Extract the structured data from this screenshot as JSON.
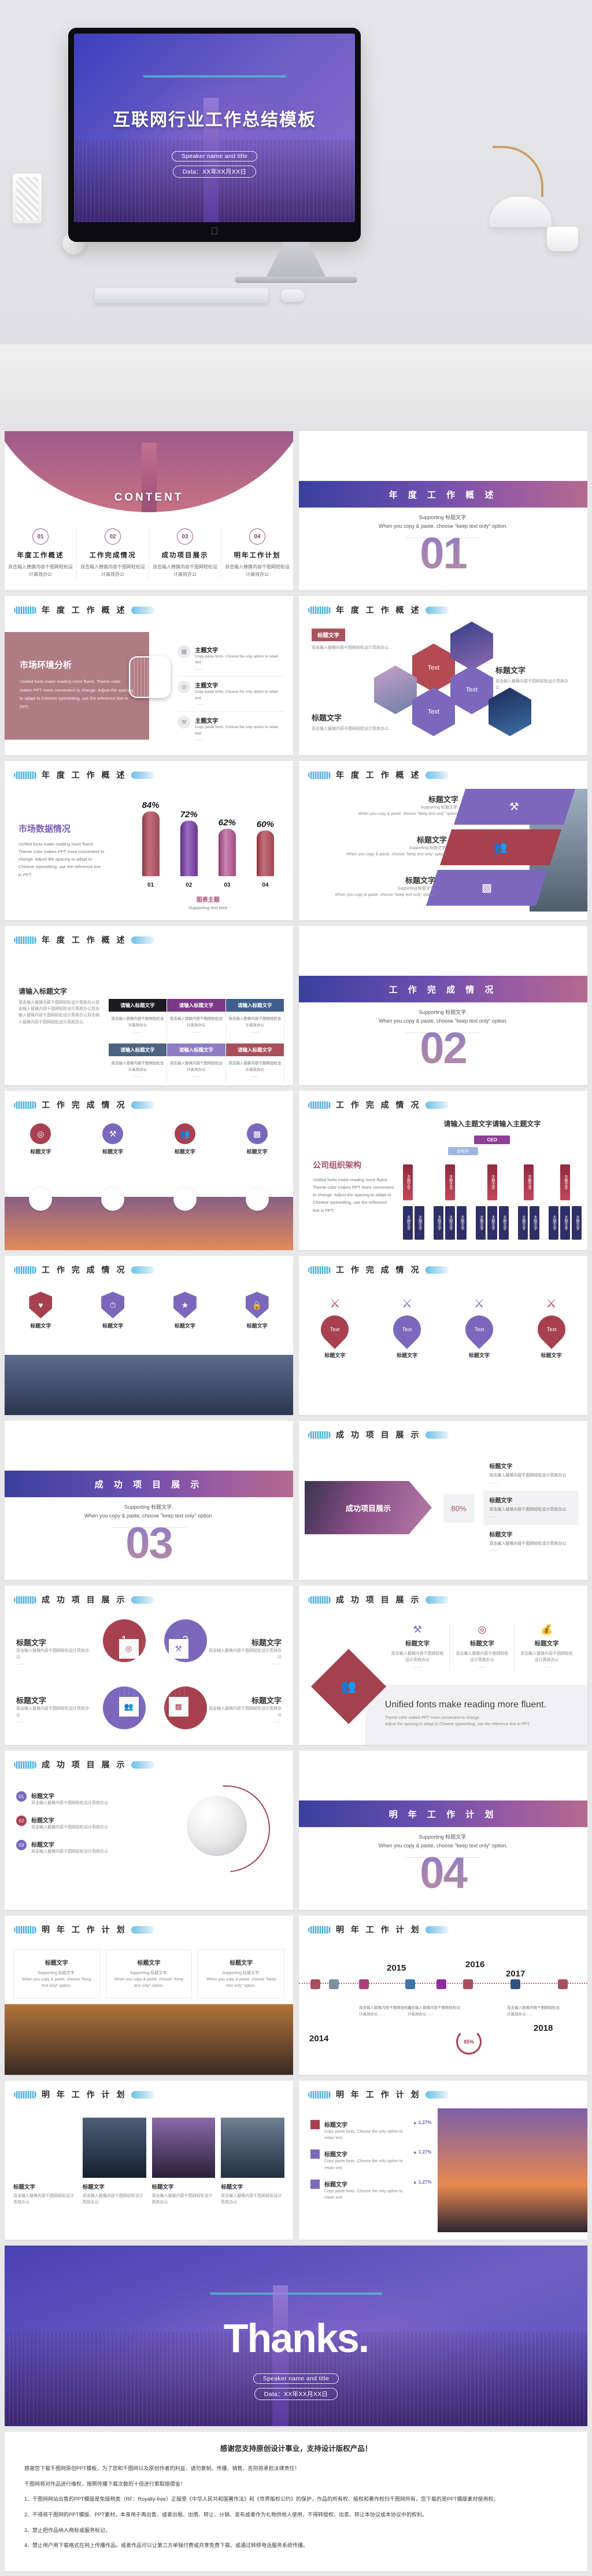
{
  "hero": {
    "title": "互联网行业工作总结模板",
    "speaker": "Speaker name and title",
    "date": "Data：XX年XX月XX日",
    "apple_logo": "apple-logo"
  },
  "colors": {
    "purple": "#7b68bd",
    "deep_purple": "#5a4fb8",
    "red": "#a8414f",
    "rose": "#b07c84",
    "blue_ribbon": "#6ec0e6",
    "magenta": "#8e3f96"
  },
  "content_slide": {
    "word": "CONTENT",
    "columns": [
      {
        "num": "01",
        "title": "年度工作概述",
        "desc": "双击输入替换内容千图网轻松设计高效办公"
      },
      {
        "num": "02",
        "title": "工作完成情况",
        "desc": "双击输入替换内容千图网轻松设计高效办公"
      },
      {
        "num": "03",
        "title": "成功项目展示",
        "desc": "双击输入替换内容千图网轻松设计高效办公"
      },
      {
        "num": "04",
        "title": "明年工作计划",
        "desc": "双击输入替换内容千图网轻松设计高效办公"
      }
    ]
  },
  "dividers": [
    {
      "num": "01",
      "title": "年 度 工 作 概 述",
      "sub1": "Supporting 标题文字.",
      "sub2": "When you copy & paste, choose \"keep text only\" option."
    },
    {
      "num": "02",
      "title": "工 作 完 成 情 况",
      "sub1": "Supporting 标题文字.",
      "sub2": "When you copy & paste, choose \"keep text only\" option."
    },
    {
      "num": "03",
      "title": "成 功 项 目 展 示",
      "sub1": "Supporting 标题文字.",
      "sub2": "When you copy & paste, choose \"keep text only\" option."
    },
    {
      "num": "04",
      "title": "明 年 工 作 计 划",
      "sub1": "Supporting 标题文字.",
      "sub2": "When you copy & paste, choose \"keep text only\" option."
    }
  ],
  "section_titles": {
    "s1": "年 度 工 作 概 述",
    "s2": "工 作 完 成 情 况",
    "s3": "成 功 项 目 展 示",
    "s4": "明 年 工 作 计 划"
  },
  "market": {
    "heading": "市场环境分析",
    "body": "Unified fonts make reading more fluent. Theme color makes PPT more convenient to change. Adjust the spacing to adapt to Chinese typesetting, use the reference line in PPT.",
    "items": [
      {
        "icon": "bar-chart-icon",
        "title": "主题文字",
        "line1": "Copy paste fonts. Choose the only option to retain text.",
        "line2": "……"
      },
      {
        "icon": "target-icon",
        "title": "主题文字",
        "line1": "Copy paste fonts. Choose the only option to retain text.",
        "line2": "……"
      },
      {
        "icon": "tools-icon",
        "title": "主题文字",
        "line1": "Copy paste fonts. Choose the only option to retain text.",
        "line2": "……"
      }
    ]
  },
  "hex_slide": {
    "tag": "标题文字",
    "tag_desc": "双击输入替换内容千图网轻松设计高效办公…",
    "right_title": "标题文字",
    "right_desc": "双击输入替换内容千图网轻松设计高效办公…",
    "bottom_title": "标题文字",
    "bottom_desc": "双击输入替换内容千图网轻松设计高效办公…",
    "hex_label": "Text"
  },
  "chart_data": {
    "type": "bar",
    "title": "市场数据情况",
    "categories": [
      "01",
      "02",
      "03",
      "04"
    ],
    "values": [
      84,
      72,
      62,
      60
    ],
    "value_labels": [
      "84%",
      "72%",
      "62%",
      "60%"
    ],
    "bar_colors": [
      "#b5545f",
      "#7a3f9e",
      "#b4528c",
      "#b9505c"
    ],
    "chart_caption": "图表主题",
    "chart_sub": "Supporting text here",
    "side_text": "Unified fonts make reading more fluent. Theme color makes PPT more convenient to change. Adjust the spacing to adapt to Chinese typesetting, use the reference line in PPT.",
    "xlabel": "",
    "ylabel": "",
    "ylim": [
      0,
      100
    ],
    "grid": false,
    "legend": "none"
  },
  "parallelogram": {
    "rows": [
      {
        "title": "标题文字",
        "l1": "Supporting 标题文字.",
        "l2": "When you copy & paste, choose \"keep text only\" option.",
        "icon": "tools-icon",
        "color": "#7b68bd"
      },
      {
        "title": "标题文字",
        "l1": "Supporting 标题文字.",
        "l2": "When you copy & paste, choose \"keep text only\" option.",
        "icon": "people-icon",
        "color": "#a8414f"
      },
      {
        "title": "标题文字",
        "l1": "Supporting 标题文字.",
        "l2": "When you copy & paste, choose \"keep text only\" option.",
        "icon": "chart-gear-icon",
        "color": "#7b68bd"
      }
    ]
  },
  "table_slide": {
    "heading": "请输入标题文字",
    "body": "双击输入替换内容千图网轻松设计高效办公双击输入替换内容千图网轻松设计高效办公双击输入替换内容千图网轻松设计高效办公双击输入替换内容千图网轻松设计高效办公.",
    "headers_row1": [
      "请输入标题文字",
      "请输入标题文字",
      "请输入标题文字"
    ],
    "headers_row2": [
      "请输入标题文字",
      "请输入标题文字",
      "请输入标题文字"
    ],
    "cell": "双击输入替换内容千图网轻松设计高效办公",
    "cell_dots": "……",
    "head_colors_r1": [
      "#1b1b22",
      "#7a3a86",
      "#3f5e8c"
    ],
    "head_colors_r2": [
      "#4d6480",
      "#8e7cc3",
      "#a8505c"
    ]
  },
  "circles_slide": {
    "items": [
      {
        "label": "标题文字",
        "color": "#a8414f"
      },
      {
        "label": "标题文字",
        "color": "#7b68bd"
      },
      {
        "label": "标题文字",
        "color": "#a8414f"
      },
      {
        "label": "标题文字",
        "color": "#7b68bd"
      }
    ]
  },
  "org_slide": {
    "heading": "请输入主题文字请输入主题文字",
    "left_title": "公司组织架构",
    "left_body": "Unified fonts make reading more fluent. Theme color makes PPT more convenient to change. Adjust the spacing to adapt to Chinese typesetting, use the reference line in PPT.",
    "ceo": "CEO",
    "gm": "总经办",
    "node": "主题文字",
    "branches": [
      2,
      3,
      3,
      2,
      3
    ]
  },
  "shield_slide": {
    "items": [
      {
        "icon": "heart-icon",
        "label": "标题文字",
        "color": "#a8414f"
      },
      {
        "icon": "gauge-icon",
        "label": "标题文字",
        "color": "#7b68bd"
      },
      {
        "icon": "shield-icon",
        "label": "标题文字",
        "color": "#7b68bd"
      },
      {
        "icon": "lock-icon",
        "label": "标题文字",
        "color": "#7b68bd"
      }
    ]
  },
  "pin_slide": {
    "items": [
      {
        "label": "标题文字",
        "text": "Text",
        "color": "#a8414f"
      },
      {
        "label": "标题文字",
        "text": "Text",
        "color": "#7b68bd"
      },
      {
        "label": "标题文字",
        "text": "Text",
        "color": "#7b68bd"
      },
      {
        "label": "标题文字",
        "text": "Text",
        "color": "#a8414f"
      }
    ]
  },
  "pyramid_slide": {
    "banner": "成功项目展示",
    "percent": "80%",
    "items": [
      {
        "title": "标题文字",
        "line": "双击输入替换内容千图网轻松设计高效办公",
        "dots": "……"
      },
      {
        "title": "标题文字",
        "line": "双击输入替换内容千图网轻松设计高效办公",
        "dots": "……"
      },
      {
        "title": "标题文字",
        "line": "双击输入替换内容千图网轻松设计高效办公",
        "dots": "……"
      }
    ]
  },
  "quad_slide": {
    "nums": [
      "1",
      "2",
      "3",
      "4"
    ],
    "title": "标题文字",
    "line": "双击输入替换内容千图网轻松设计高效办公",
    "dots": "……",
    "icons": [
      "target-icon",
      "tools-icon",
      "people-icon",
      "chart-gear-icon"
    ]
  },
  "diamond_slide": {
    "cols": [
      {
        "icon": "tools-icon",
        "title": "标题文字",
        "text": "双击输入替换内容千图网轻松设计高效办公",
        "dots": "……"
      },
      {
        "icon": "target-icon",
        "title": "标题文字",
        "text": "双击输入替换内容千图网轻松设计高效办公",
        "dots": "……"
      },
      {
        "icon": "dollar-icon",
        "title": "标题文字",
        "text": "双击输入替换内容千图网轻松设计高效办公",
        "dots": "……"
      }
    ],
    "panel_title": "Unified fonts make reading more fluent.",
    "panel_l1": "Theme color makes PPT more convenient to change.",
    "panel_l2": "Adjust the spacing to adapt to Chinese typesetting, use the reference line in PPT."
  },
  "globe_slide": {
    "bullets": [
      {
        "num": "01",
        "title": "标题文字",
        "text": "双击输入替换内容千图网轻松设计高效办公",
        "color": "#7b68bd"
      },
      {
        "num": "02",
        "title": "标题文字",
        "text": "双击输入替换内容千图网轻松设计高效办公",
        "color": "#a8414f"
      },
      {
        "num": "03",
        "title": "标题文字",
        "text": "双击输入替换内容千图网轻松设计高效办公",
        "color": "#7b68bd"
      }
    ]
  },
  "plan_cards": {
    "items": [
      {
        "title": "标题文字",
        "sub": "Supporting 标题文字.",
        "text": "When you copy & paste, choose \"keep text only\" option."
      },
      {
        "title": "标题文字",
        "sub": "Supporting 标题文字.",
        "text": "When you copy & paste, choose \"keep text only\" option."
      },
      {
        "title": "标题文字",
        "sub": "Supporting 标题文字.",
        "text": "When you copy & paste, choose \"keep text only\" option."
      }
    ]
  },
  "timeline": {
    "years": [
      "2014",
      "2015",
      "2016",
      "2017",
      "2018"
    ],
    "desc": "双击输入替换内容千图网轻松设计高效办公……",
    "ring_label": "85%",
    "node_colors": [
      "#a8505c",
      "#7e8fa0",
      "#a8407a",
      "#3f74a8",
      "#8e2f9e",
      "#a8505c",
      "#2f5480",
      "#a8505c"
    ]
  },
  "photo_cards": {
    "items": [
      {
        "title": "标题文字",
        "text": "双击输入替换内容千图网轻松设计高效办公"
      },
      {
        "title": "标题文字",
        "text": "双击输入替换内容千图网轻松设计高效办公"
      },
      {
        "title": "标题文字",
        "text": "双击输入替换内容千图网轻松设计高效办公"
      },
      {
        "title": "标题文字",
        "text": "双击输入替换内容千图网轻松设计高效办公"
      }
    ]
  },
  "kpi_slide": {
    "rows": [
      {
        "title": "标题文字",
        "text": "Copy paste fonts. Choose the only option to retain text.",
        "pct": "▲ 1.27%",
        "color": "#a8414f"
      },
      {
        "title": "标题文字",
        "text": "Copy paste fonts. Choose the only option to retain text.",
        "pct": "▲ 1.27%",
        "color": "#7b68bd"
      },
      {
        "title": "标题文字",
        "text": "Copy paste fonts. Choose the only option to retain text.",
        "pct": "▲ 1.27%",
        "color": "#7b68bd"
      }
    ]
  },
  "thanks": {
    "title": "Thanks.",
    "speaker": "Speaker name and title",
    "date": "Data：XX年XX月XX日"
  },
  "legal": {
    "heading": "感谢您支持原创设计事业，支持设计版权产品！",
    "p1": "感谢您下载千图网原创PPT模板，为了您和千图网以及原创作者的利益，请勿复制、传播、销售，否则将承担法律责任！",
    "p2": "千图网将对作品进行维权，按照传播下载次数的十倍进行索取赔偿金！",
    "p3": "1、千图网网站出售的PPT模版是免版税类（RF：Royalty-free）正版受《中华人民共和国著作法》和《世界版权公约》的保护，作品的所有权、版权和著作权归千图网所有，您下载的是PPT模版素材使用权。",
    "p4": "2、不得将千图网的PPT模版、PPT素材，本身用于再出售，或者出租、出借、转让、分销、发布或者作为礼物供他人使用，不得转授权、出卖、转让本协议或本协议中的权利。",
    "p5": "3、禁止把作品纳入商标或服务标记。",
    "p6": "4、禁止用户用下载格式在网上传播作品。或者作品可以让第三方单独付费或共享免费下载、或通过转移电话服务系统传播。"
  }
}
